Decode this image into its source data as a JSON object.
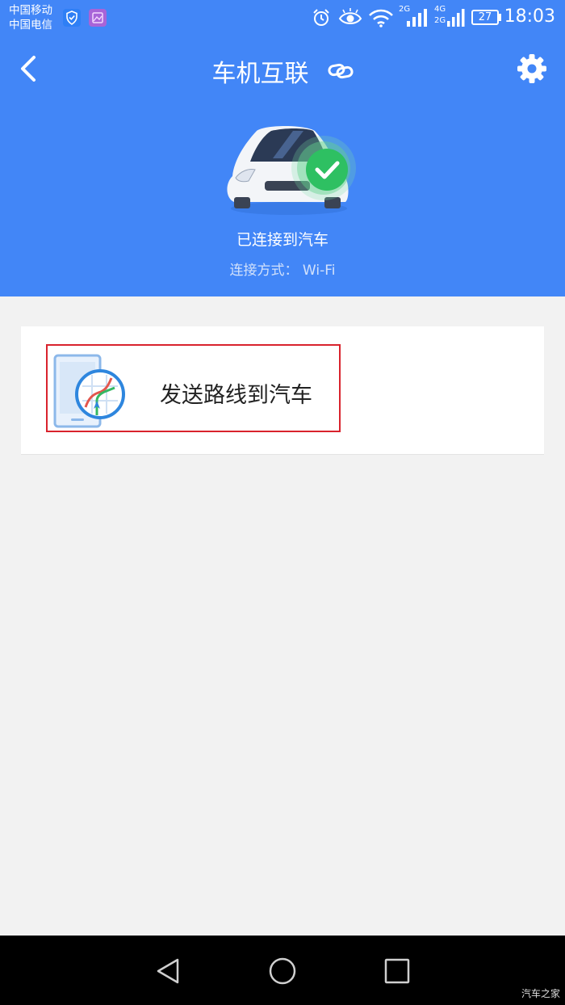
{
  "status_bar": {
    "carrier_1": "中国移动",
    "carrier_2": "中国电信",
    "net_2g": "2G",
    "net_4g": "4G",
    "net_2g_b": "2G",
    "battery": "27",
    "time": "18:03",
    "icons": [
      "shield-icon",
      "gallery-icon",
      "alarm-icon",
      "eye-icon",
      "wifi-icon",
      "signal-icon",
      "battery-icon"
    ]
  },
  "navbar": {
    "title": "车机互联",
    "icons": [
      "back-icon",
      "link-icon",
      "gear-icon"
    ]
  },
  "connection": {
    "status": "已连接到汽车",
    "method": "连接方式： Wi-Fi"
  },
  "actions": {
    "send_route_label": "发送路线到汽车"
  },
  "system_nav": {
    "icons": [
      "back-triangle-icon",
      "home-circle-icon",
      "recents-square-icon"
    ]
  },
  "watermark": "汽车之家",
  "colors": {
    "header_blue": "#4286f7",
    "check_green": "#2ec062",
    "highlight_red": "#d9232d",
    "background": "#f2f2f2"
  }
}
